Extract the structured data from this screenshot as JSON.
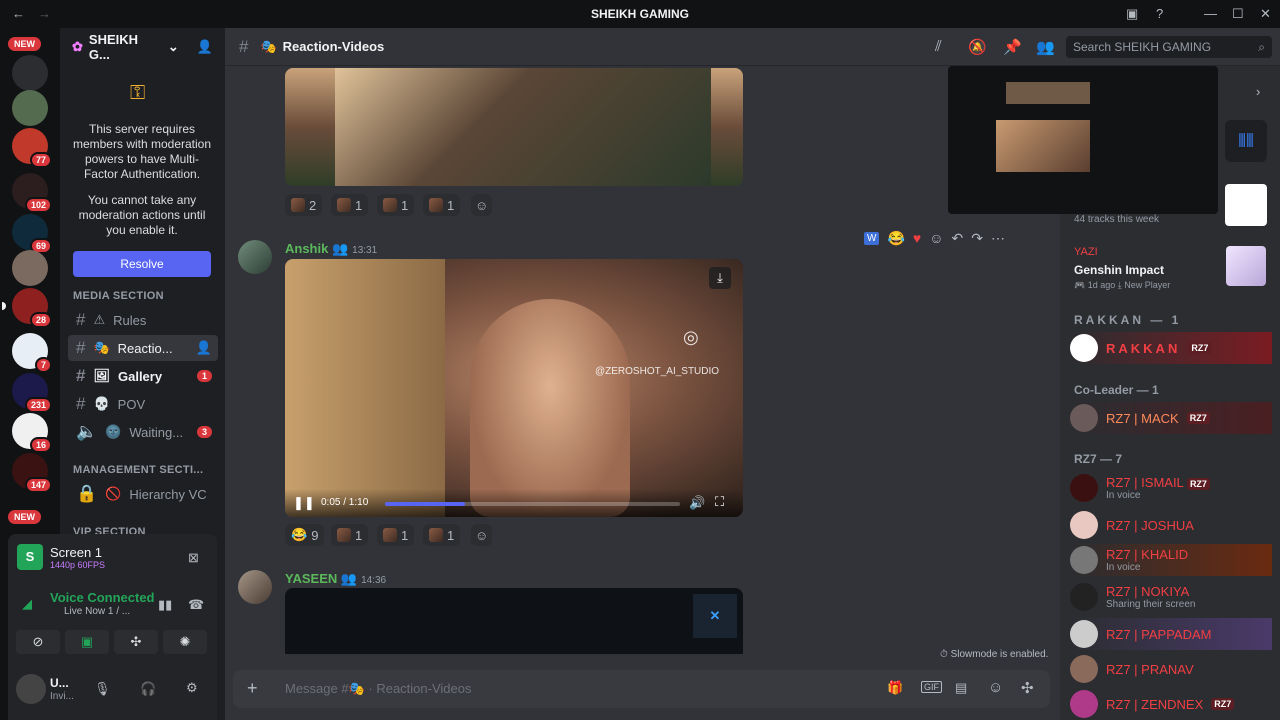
{
  "window": {
    "title": "SHEIKH GAMING"
  },
  "guilds": {
    "new_top": "NEW",
    "new_bottom": "NEW",
    "badges": [
      "77",
      "102",
      "69",
      "28",
      "7",
      "231",
      "16",
      "147"
    ]
  },
  "server": {
    "name": "SHEIKH G...",
    "mfa_text": "This server requires members with moderation powers to have Multi-Factor Authentication.",
    "mfa_text2": "You cannot take any moderation actions until you enable it.",
    "resolve_label": "Resolve"
  },
  "categories": {
    "media": "MEDIA SECTION",
    "management": "MANAGEMENT SECTI...",
    "vip": "VIP SECTION"
  },
  "channels": [
    {
      "name": "Rules",
      "emoji": "⚠"
    },
    {
      "name": "Reactio...",
      "emoji": "🎭"
    },
    {
      "name": "Gallery",
      "emoji": "🖼",
      "badge": "1"
    },
    {
      "name": "POV",
      "emoji": "💀"
    },
    {
      "name": "Waiting...",
      "emoji": "🌚",
      "badge": "3"
    },
    {
      "name": "Hierarchy VC",
      "emoji": "🚫"
    }
  ],
  "panel": {
    "stream_title": "Screen 1",
    "stream_quality": "1440p 60FPS",
    "voice_status": "Voice Connected",
    "voice_detail": "Live Now 1 / ...",
    "user_short": "U...",
    "user_status": "Invi..."
  },
  "header": {
    "channel": "Reaction-Videos",
    "search_placeholder": "Search SHEIKH GAMING"
  },
  "messages": [
    {
      "author": "Anshik",
      "time": "13:31",
      "video_time": "0:05 / 1:10",
      "watermark": "@ZEROSHOT_AI_STUDIO",
      "reactions": [
        {
          "c": "9"
        },
        {
          "c": "1"
        },
        {
          "c": "1"
        },
        {
          "c": "1"
        }
      ]
    },
    {
      "author": "YASEEN",
      "time": "14:36"
    }
  ],
  "top_reactions": [
    {
      "c": "2"
    },
    {
      "c": "1"
    },
    {
      "c": "1"
    },
    {
      "c": "1"
    }
  ],
  "composer": {
    "placeholder": "Message #🎭 · Reaction-Videos",
    "slowmode": "Slowmode is enabled."
  },
  "members": {
    "tracks": "44 tracks this week",
    "activity": {
      "user": "YAZI",
      "game": "Genshin Impact",
      "detail": "1d ago",
      "detail2": "New Player"
    },
    "groups": [
      {
        "label": "RAKKAN — 1",
        "members": [
          {
            "name": "RAKKAN",
            "tag": "RZ7"
          }
        ]
      },
      {
        "label": "Co-Leader — 1",
        "members": [
          {
            "name": "RZ7 | MACK",
            "tag": "RZ7"
          }
        ]
      },
      {
        "label": "RZ7 — 7",
        "members": [
          {
            "name": "RZ7 | ISMAIL",
            "tag": "RZ7",
            "sub": "In voice"
          },
          {
            "name": "RZ7 | JOSHUA"
          },
          {
            "name": "RZ7 | KHALID",
            "sub": "In voice"
          },
          {
            "name": "RZ7 | NOKIYA",
            "sub": "Sharing their screen"
          },
          {
            "name": "RZ7 | PAPPADAM"
          },
          {
            "name": "RZ7 | PRANAV"
          },
          {
            "name": "RZ7 | ZENDNEX",
            "tag": "RZ7"
          }
        ]
      }
    ]
  }
}
